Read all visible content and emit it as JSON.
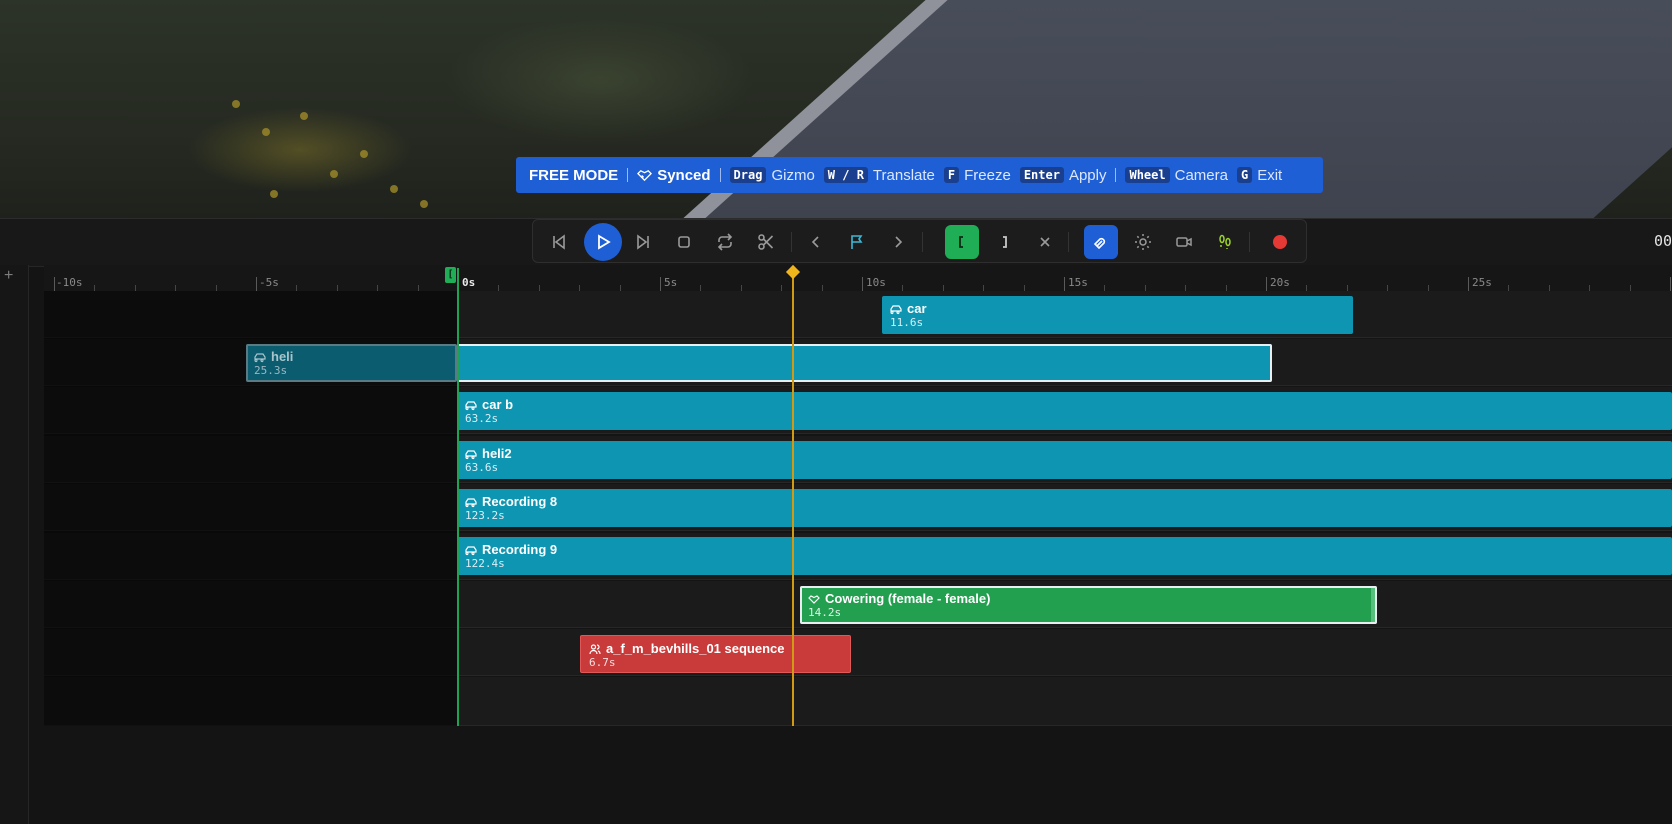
{
  "banner": {
    "mode": "FREE MODE",
    "synced": "Synced",
    "hints": [
      {
        "key": "Drag",
        "label": "Gizmo"
      },
      {
        "key": "W / R",
        "label": "Translate"
      },
      {
        "key": "F",
        "label": "Freeze"
      },
      {
        "key": "Enter",
        "label": "Apply"
      },
      {
        "key": "Wheel",
        "label": "Camera"
      },
      {
        "key": "G",
        "label": "Exit"
      }
    ]
  },
  "toolbar": {
    "buttons": [
      "skip-back",
      "play",
      "skip-forward",
      "stop",
      "loop",
      "cut",
      "prev-marker",
      "marker-flag",
      "next-marker",
      "mark-in",
      "mark-out",
      "clear-range",
      "magnet",
      "light",
      "camera",
      "footsteps",
      "record"
    ],
    "colors": {
      "play": "#1f5fd6",
      "mark_in": "#1fae56",
      "magnet": "#1f5fd6",
      "record": "#e53935",
      "flag": "#3bb8d6",
      "footsteps": "#9bd22a"
    }
  },
  "clock": {
    "text": "00"
  },
  "sidebar": {
    "add_label": "+"
  },
  "ruler": {
    "labels": [
      "-10s",
      "-5s",
      "0s",
      "5s",
      "10s",
      "15s",
      "20s",
      "25s"
    ],
    "start_marker": "["
  },
  "clips": [
    {
      "name": "car",
      "duration": "11.6s",
      "type": "vehicle",
      "color": "#0d95b2"
    },
    {
      "name": "heli",
      "duration": "25.3s",
      "type": "vehicle",
      "color": "#0d95b2",
      "selected": true
    },
    {
      "name": "car b",
      "duration": "63.2s",
      "type": "vehicle",
      "color": "#0d95b2"
    },
    {
      "name": "heli2",
      "duration": "63.6s",
      "type": "vehicle",
      "color": "#0d95b2"
    },
    {
      "name": "Recording 8",
      "duration": "123.2s",
      "type": "vehicle",
      "color": "#0d95b2"
    },
    {
      "name": "Recording 9",
      "duration": "122.4s",
      "type": "vehicle",
      "color": "#0d95b2"
    },
    {
      "name": "Cowering (female - female)",
      "duration": "14.2s",
      "type": "animation",
      "color": "#22a04f",
      "selected": true
    },
    {
      "name": "a_f_m_bevhills_01 sequence",
      "duration": "6.7s",
      "type": "ped",
      "color": "#c93a3a"
    }
  ]
}
